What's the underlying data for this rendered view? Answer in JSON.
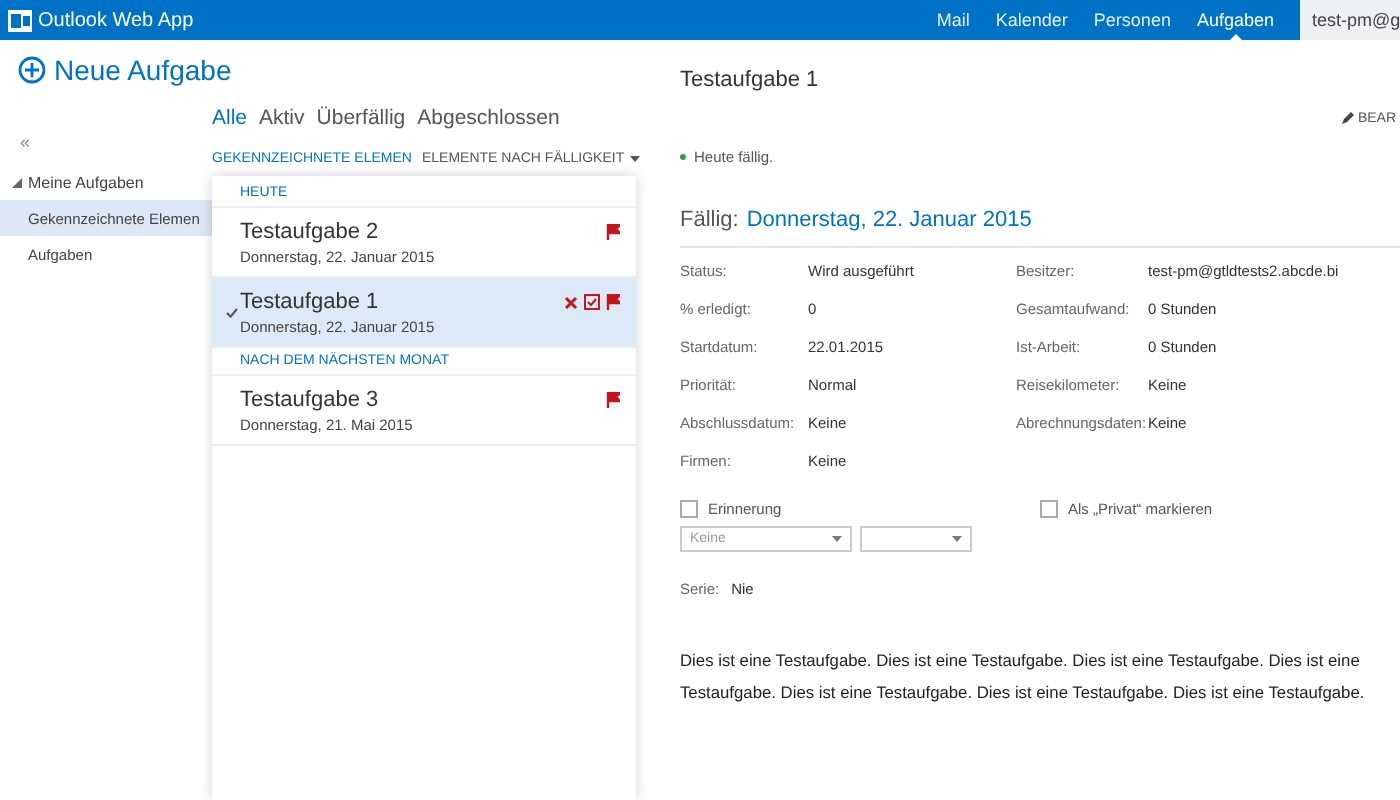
{
  "app_bar": {
    "title": "Outlook Web App",
    "nav": [
      {
        "label": "Mail",
        "selected": false
      },
      {
        "label": "Kalender",
        "selected": false
      },
      {
        "label": "Personen",
        "selected": false
      },
      {
        "label": "Aufgaben",
        "selected": true
      }
    ],
    "user": "test-pm@g"
  },
  "new_task": {
    "label": "Neue Aufgabe"
  },
  "sidebar": {
    "collapse": "«",
    "items": [
      {
        "label": "Meine Aufgaben",
        "expanded": true,
        "children": [
          {
            "label": "Gekennzeichnete Elemen",
            "selected": true
          },
          {
            "label": "Aufgaben",
            "selected": false
          }
        ]
      }
    ]
  },
  "filters": [
    {
      "label": "Alle",
      "selected": true
    },
    {
      "label": "Aktiv",
      "selected": false
    },
    {
      "label": "Überfällig",
      "selected": false
    },
    {
      "label": "Abgeschlossen",
      "selected": false
    }
  ],
  "sort": {
    "view": "GEKENNZEICHNETE ELEMEN",
    "order": "ELEMENTE NACH FÄLLIGKEIT"
  },
  "groups": [
    {
      "header": "HEUTE",
      "tasks": [
        {
          "title": "Testaufgabe 2",
          "date": "Donnerstag, 22. Januar 2015",
          "flagged": true,
          "selected": false
        },
        {
          "title": "Testaufgabe 1",
          "date": "Donnerstag, 22. Januar 2015",
          "flagged": true,
          "selected": true
        }
      ]
    },
    {
      "header": "NACH DEM NÄCHSTEN MONAT",
      "tasks": [
        {
          "title": "Testaufgabe 3",
          "date": "Donnerstag, 21. Mai 2015",
          "flagged": true,
          "selected": false
        }
      ]
    }
  ],
  "detail": {
    "title": "Testaufgabe 1",
    "edit": "BEAR",
    "due_note": "Heute fällig.",
    "due_label": "Fällig:",
    "due_date": "Donnerstag, 22. Januar 2015",
    "fields_left": [
      {
        "label": "Status:",
        "value": "Wird ausgeführt"
      },
      {
        "label": "% erledigt:",
        "value": "0"
      },
      {
        "label": "Startdatum:",
        "value": "22.01.2015"
      },
      {
        "label": "Priorität:",
        "value": "Normal"
      },
      {
        "label": "Abschlussdatum:",
        "value": "Keine"
      },
      {
        "label": "Firmen:",
        "value": "Keine"
      }
    ],
    "fields_right": [
      {
        "label": "Besitzer:",
        "value": "test-pm@gtldtests2.abcde.bi"
      },
      {
        "label": "Gesamtaufwand:",
        "value": "0 Stunden"
      },
      {
        "label": "Ist-Arbeit:",
        "value": "0 Stunden"
      },
      {
        "label": "Reisekilometer:",
        "value": "Keine"
      },
      {
        "label": "Abrechnungsdaten:",
        "value": "Keine"
      }
    ],
    "reminder": {
      "label": "Erinnerung",
      "checked": false
    },
    "reminder_date": {
      "value": "Keine"
    },
    "private": {
      "label": "Als „Privat“ markieren",
      "checked": false
    },
    "series_label": "Serie:",
    "series_value": "Nie",
    "body": "Dies ist eine Testaufgabe. Dies ist eine Testaufgabe. Dies ist eine Testaufgabe. Dies ist eine Testaufgabe. Dies ist eine Testaufgabe. Dies ist eine Testaufgabe. Dies ist eine Testaufgabe."
  }
}
